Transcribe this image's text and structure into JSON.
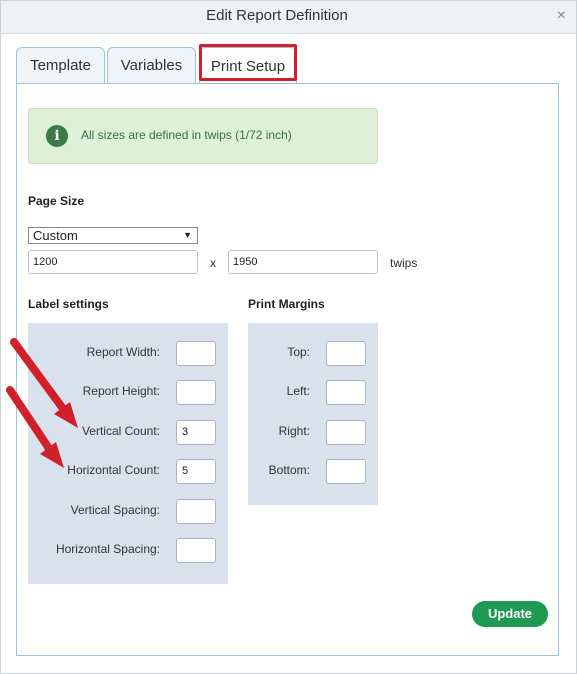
{
  "dialog": {
    "title": "Edit Report Definition",
    "close_glyph": "×"
  },
  "tabs": [
    {
      "label": "Template",
      "active": false
    },
    {
      "label": "Variables",
      "active": false
    },
    {
      "label": "Print Setup",
      "active": true
    }
  ],
  "info": {
    "icon": "info-icon",
    "text": "All sizes are defined in twips (1/72 inch)"
  },
  "page_size": {
    "heading": "Page Size",
    "select_value": "Custom",
    "width": "1200",
    "separator": "x",
    "height": "1950",
    "unit": "twips"
  },
  "label_settings": {
    "heading": "Label settings",
    "fields": [
      {
        "label": "Report Width:",
        "value": ""
      },
      {
        "label": "Report Height:",
        "value": ""
      },
      {
        "label": "Vertical Count:",
        "value": "3"
      },
      {
        "label": "Horizontal Count:",
        "value": "5"
      },
      {
        "label": "Vertical Spacing:",
        "value": ""
      },
      {
        "label": "Horizontal Spacing:",
        "value": ""
      }
    ]
  },
  "print_margins": {
    "heading": "Print Margins",
    "fields": [
      {
        "label": "Top:",
        "value": ""
      },
      {
        "label": "Left:",
        "value": ""
      },
      {
        "label": "Right:",
        "value": ""
      },
      {
        "label": "Bottom:",
        "value": ""
      }
    ]
  },
  "actions": {
    "update_label": "Update"
  },
  "colors": {
    "accent_green": "#1f9a52",
    "info_bg": "#dff0d8",
    "highlight_red": "#d0202a",
    "settings_bg": "#d9e1ec"
  }
}
